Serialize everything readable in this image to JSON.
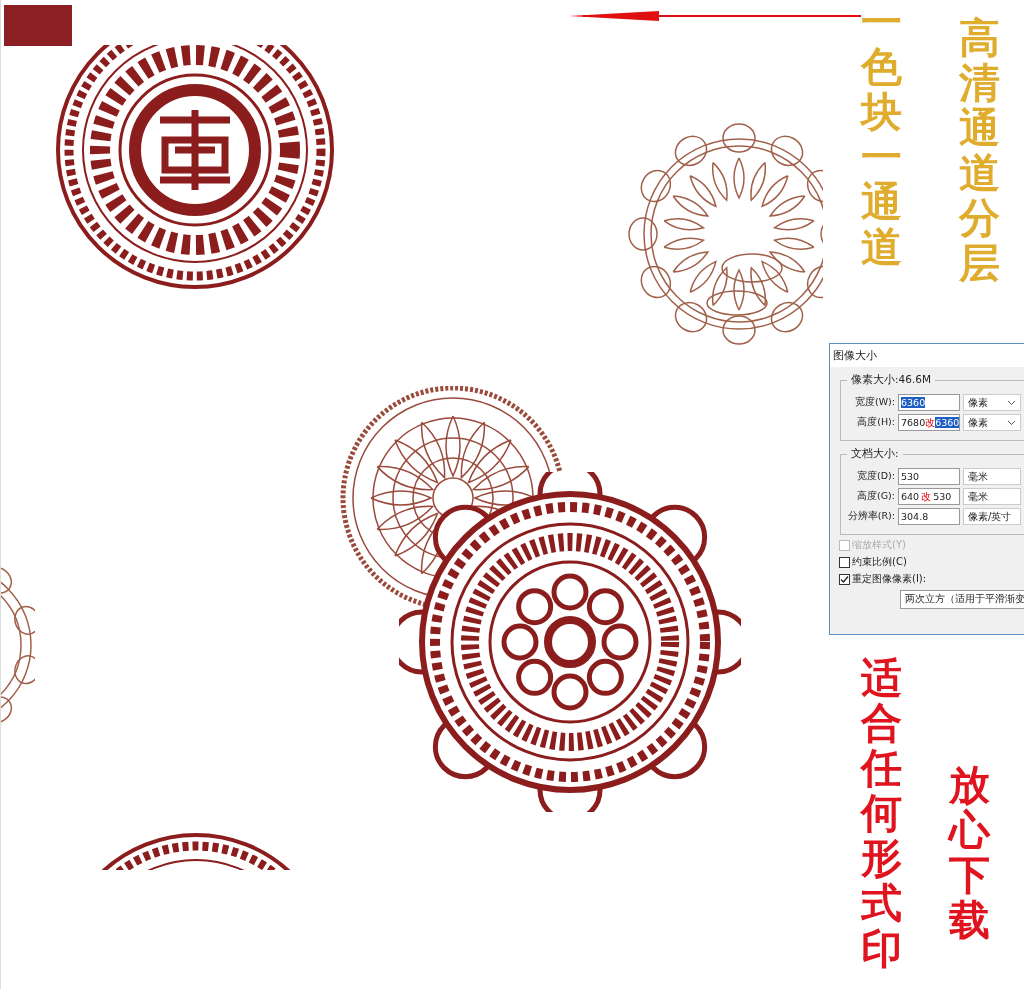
{
  "captions": [
    {
      "text": "一色块一通道",
      "color": "#e0ac2e"
    },
    {
      "text": "高清通道分层",
      "color": "#e0ac2e"
    },
    {
      "text": "适合任何形式印",
      "color": "#e0141e"
    },
    {
      "text": "放心下载",
      "color": "#e0141e"
    }
  ],
  "dialog": {
    "title": "图像大小",
    "pixel_group": {
      "label": "像素大小:46.6M",
      "rows": [
        {
          "label": "宽度(W):",
          "value": "6360",
          "selected": true,
          "unit": "像素"
        },
        {
          "label": "高度(H):",
          "value": "7680",
          "annotation": "改",
          "new_value": "6360",
          "selected": true,
          "unit": "像素"
        }
      ]
    },
    "document_group": {
      "label": "文档大小:",
      "rows": [
        {
          "label": "宽度(D):",
          "value": "530",
          "unit": "毫米"
        },
        {
          "label": "高度(G):",
          "value": "640",
          "annotation": "改",
          "new_value": "530",
          "unit": "毫米"
        },
        {
          "label": "分辨率(R):",
          "value": "304.8",
          "unit": "像素/英寸"
        }
      ]
    },
    "options": [
      {
        "label": "缩放样式(Y)",
        "checked": false,
        "disabled": true
      },
      {
        "label": "约束比例(C)",
        "checked": false,
        "disabled": false
      },
      {
        "label": "重定图像像素(I):",
        "checked": true,
        "disabled": false
      }
    ],
    "resample": "两次立方（适用于平滑渐变"
  }
}
